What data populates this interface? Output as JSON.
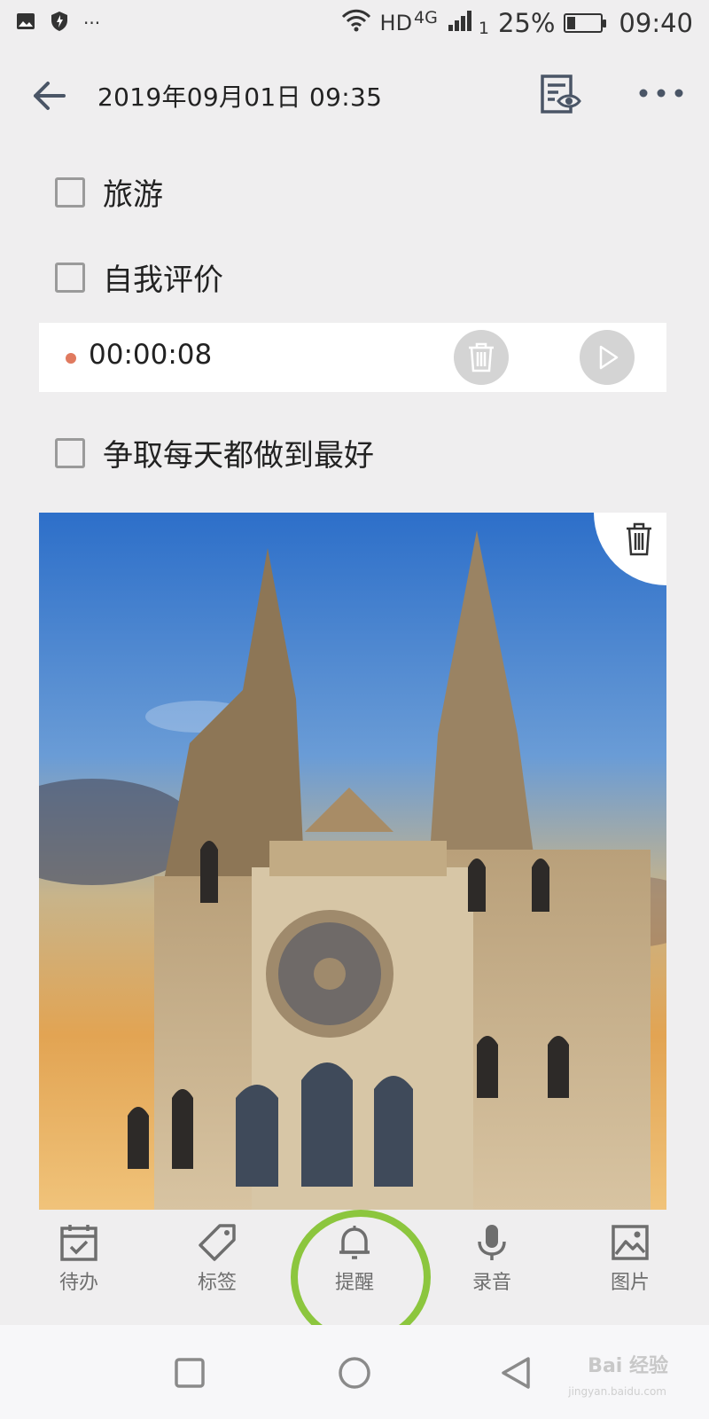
{
  "status_bar": {
    "network_label": "HD",
    "network_gen": "4G",
    "sim_indicator": "1",
    "battery_percent": "25%",
    "battery_level": 0.25,
    "time": "09:40",
    "overflow": "···"
  },
  "header": {
    "title": "2019年09月01日 09:35"
  },
  "checklist": [
    {
      "label": "旅游",
      "checked": false
    },
    {
      "label": "自我评价",
      "checked": false
    },
    {
      "label": "争取每天都做到最好",
      "checked": false
    }
  ],
  "audio": {
    "duration": "00:00:08"
  },
  "toolbar": {
    "items": [
      {
        "label": "待办",
        "icon": "calendar-check-icon"
      },
      {
        "label": "标签",
        "icon": "tag-icon"
      },
      {
        "label": "提醒",
        "icon": "bell-icon"
      },
      {
        "label": "录音",
        "icon": "microphone-icon"
      },
      {
        "label": "图片",
        "icon": "image-icon"
      }
    ]
  },
  "watermark": {
    "text": "Bai 经验",
    "sub": "jingyan.baidu.com"
  },
  "colors": {
    "background": "#efeeef",
    "highlight": "#8cc63e",
    "record_dot": "#e07a5f",
    "icon_gray": "#7a7a7a"
  }
}
